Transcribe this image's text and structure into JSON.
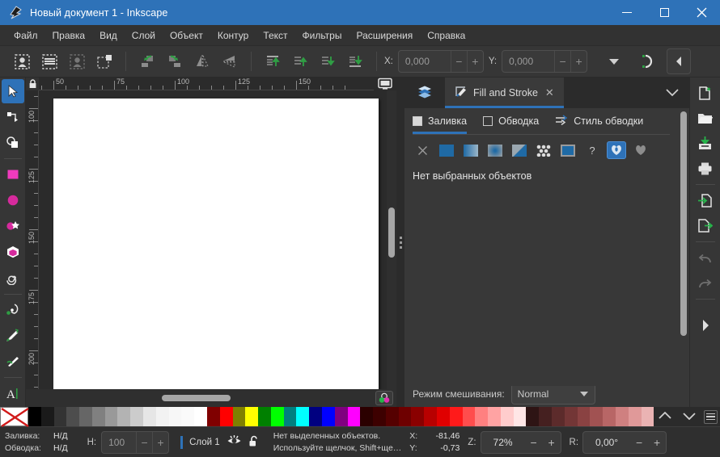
{
  "window": {
    "title": "Новый документ 1 - Inkscape",
    "app_icon": "inkscape-logo-icon",
    "controls": {
      "minimize": "−",
      "maximize": "□",
      "close": "✕"
    }
  },
  "menubar": {
    "items": [
      {
        "label": "Файл"
      },
      {
        "label": "Правка"
      },
      {
        "label": "Вид"
      },
      {
        "label": "Слой"
      },
      {
        "label": "Объект"
      },
      {
        "label": "Контур"
      },
      {
        "label": "Текст"
      },
      {
        "label": "Фильтры"
      },
      {
        "label": "Расширения"
      },
      {
        "label": "Справка"
      }
    ]
  },
  "commandbar": {
    "select_tools": [
      {
        "name": "select-all-icon"
      },
      {
        "name": "select-all-layers-icon"
      },
      {
        "name": "deselect-icon"
      },
      {
        "name": "select-same-icon"
      }
    ],
    "transform_tools": [
      {
        "name": "rotate-ccw-icon"
      },
      {
        "name": "rotate-cw-icon"
      },
      {
        "name": "flip-horizontal-icon"
      },
      {
        "name": "flip-vertical-icon"
      }
    ],
    "raise_tools": [
      {
        "name": "raise-to-top-icon"
      },
      {
        "name": "raise-icon"
      },
      {
        "name": "lower-icon"
      },
      {
        "name": "lower-to-bottom-icon"
      }
    ],
    "x_label": "X:",
    "x_value": "0,000",
    "y_label": "Y:",
    "y_value": "0,000",
    "units_caret": "chevron-down-icon",
    "snap_icon": "snap-controls-icon",
    "collapse_icon": "chevron-left-icon"
  },
  "toolbox": {
    "tools": [
      {
        "name": "selector-tool",
        "active": true
      },
      {
        "name": "node-tool",
        "active": false
      },
      {
        "name": "shape-builder-tool",
        "active": false
      },
      {
        "name": "rectangle-tool",
        "active": false
      },
      {
        "name": "ellipse-tool",
        "active": false
      },
      {
        "name": "star-tool",
        "active": false
      },
      {
        "name": "3dbox-tool",
        "active": false
      },
      {
        "name": "spiral-tool",
        "active": false
      },
      {
        "name": "pencil-tool",
        "active": false
      },
      {
        "name": "pen-tool",
        "active": false
      },
      {
        "name": "calligraphy-tool",
        "active": false
      },
      {
        "name": "text-tool",
        "active": false
      }
    ]
  },
  "canvas": {
    "ruler_lock_icon": "lock-icon",
    "ruler_display_icon": "monitor-icon",
    "hruler_labels": [
      "50",
      "75",
      "100",
      "125",
      "150"
    ],
    "vruler_labels": [
      "100",
      "125",
      "150",
      "175",
      "200"
    ],
    "color_manage_icon": "color-management-icon"
  },
  "dock": {
    "tabs": [
      {
        "name": "layers-tab",
        "label": "",
        "icon": "layers-icon",
        "active": false
      },
      {
        "name": "fill-and-stroke-tab",
        "label": "Fill and Stroke",
        "icon": "fill-stroke-icon",
        "active": true,
        "closable": true
      }
    ],
    "caret_icon": "chevron-down-icon",
    "subtabs": [
      {
        "label": "Заливка",
        "icon": "filled-square-icon",
        "active": true
      },
      {
        "label": "Обводка",
        "icon": "empty-square-icon",
        "active": false
      },
      {
        "label": "Стиль обводки",
        "icon": "stroke-style-icon",
        "active": false
      }
    ],
    "fill_types": [
      {
        "name": "no-paint-button",
        "kind": "none",
        "selected": false
      },
      {
        "name": "flat-color-button",
        "kind": "flat",
        "selected": false
      },
      {
        "name": "linear-gradient-button",
        "kind": "linear",
        "selected": false
      },
      {
        "name": "radial-gradient-button",
        "kind": "radial",
        "selected": false
      },
      {
        "name": "mesh-gradient-button",
        "kind": "mesh",
        "selected": false
      },
      {
        "name": "pattern-button",
        "kind": "pattern",
        "selected": false
      },
      {
        "name": "swatch-button",
        "kind": "swatch",
        "selected": false
      },
      {
        "name": "unknown-paint-button",
        "kind": "unknown",
        "selected": false,
        "glyph": "?"
      },
      {
        "name": "fill-rule-evenodd-button",
        "kind": "evenodd",
        "selected": true
      },
      {
        "name": "fill-rule-nonzero-button",
        "kind": "nonzero",
        "selected": false
      }
    ],
    "message": "Нет выбранных объектов",
    "blend_label": "Режим смешивания:",
    "blend_value": "Normal"
  },
  "right_strip": {
    "buttons": [
      {
        "name": "new-document-icon"
      },
      {
        "name": "open-document-icon"
      },
      {
        "name": "save-document-icon"
      },
      {
        "name": "print-document-icon"
      },
      {
        "name": "import-icon"
      },
      {
        "name": "export-icon"
      },
      {
        "name": "undo-icon",
        "disabled": true
      },
      {
        "name": "redo-icon",
        "disabled": true
      },
      {
        "name": "expand-right-icon"
      }
    ]
  },
  "palette": {
    "none_swatch": "none-color-x-icon",
    "colors": [
      "#000000",
      "#1a1a1a",
      "#333333",
      "#4d4d4d",
      "#666666",
      "#808080",
      "#999999",
      "#b3b3b3",
      "#cccccc",
      "#e6e6e6",
      "#f2f2f2",
      "#f7f7f7",
      "#fafafa",
      "#ffffff",
      "#800000",
      "#ff0000",
      "#808000",
      "#ffff00",
      "#008000",
      "#00ff00",
      "#008080",
      "#00ffff",
      "#000080",
      "#0000ff",
      "#800080",
      "#ff00ff",
      "#2b0000",
      "#3d0000",
      "#550000",
      "#6e0000",
      "#8a0000",
      "#b80000",
      "#e00000",
      "#ff1a1a",
      "#ff4d4d",
      "#ff8080",
      "#ffa3a3",
      "#ffcccc",
      "#ffe6e6",
      "#2e1414",
      "#452020",
      "#5c2b2b",
      "#733636",
      "#8a4242",
      "#a15252",
      "#b86666",
      "#cf8080",
      "#e09999",
      "#eab3b3"
    ],
    "scroll_up_icon": "chevron-up-icon",
    "scroll_down_icon": "chevron-down-icon",
    "menu_icon": "palette-menu-icon"
  },
  "statusbar": {
    "fill_label": "Заливка:",
    "fill_value": "Н/Д",
    "stroke_label": "Обводка:",
    "stroke_value": "Н/Д",
    "opacity_label": "Н:",
    "opacity_value": "100",
    "layer_name": "Слой 1",
    "layer_visibility_icon": "eye-icon",
    "layer_lock_icon": "unlocked-icon",
    "message_line1": "Нет выделенных объектов.",
    "message_line2": "Используйте щелчок, Shift+ще…",
    "cursor_x_label": "X:",
    "cursor_x_value": "-81,46",
    "cursor_y_label": "Y:",
    "cursor_y_value": "-0,73",
    "zoom_label": "Z:",
    "zoom_value": "72%",
    "rotation_label": "R:",
    "rotation_value": "0,00°"
  }
}
